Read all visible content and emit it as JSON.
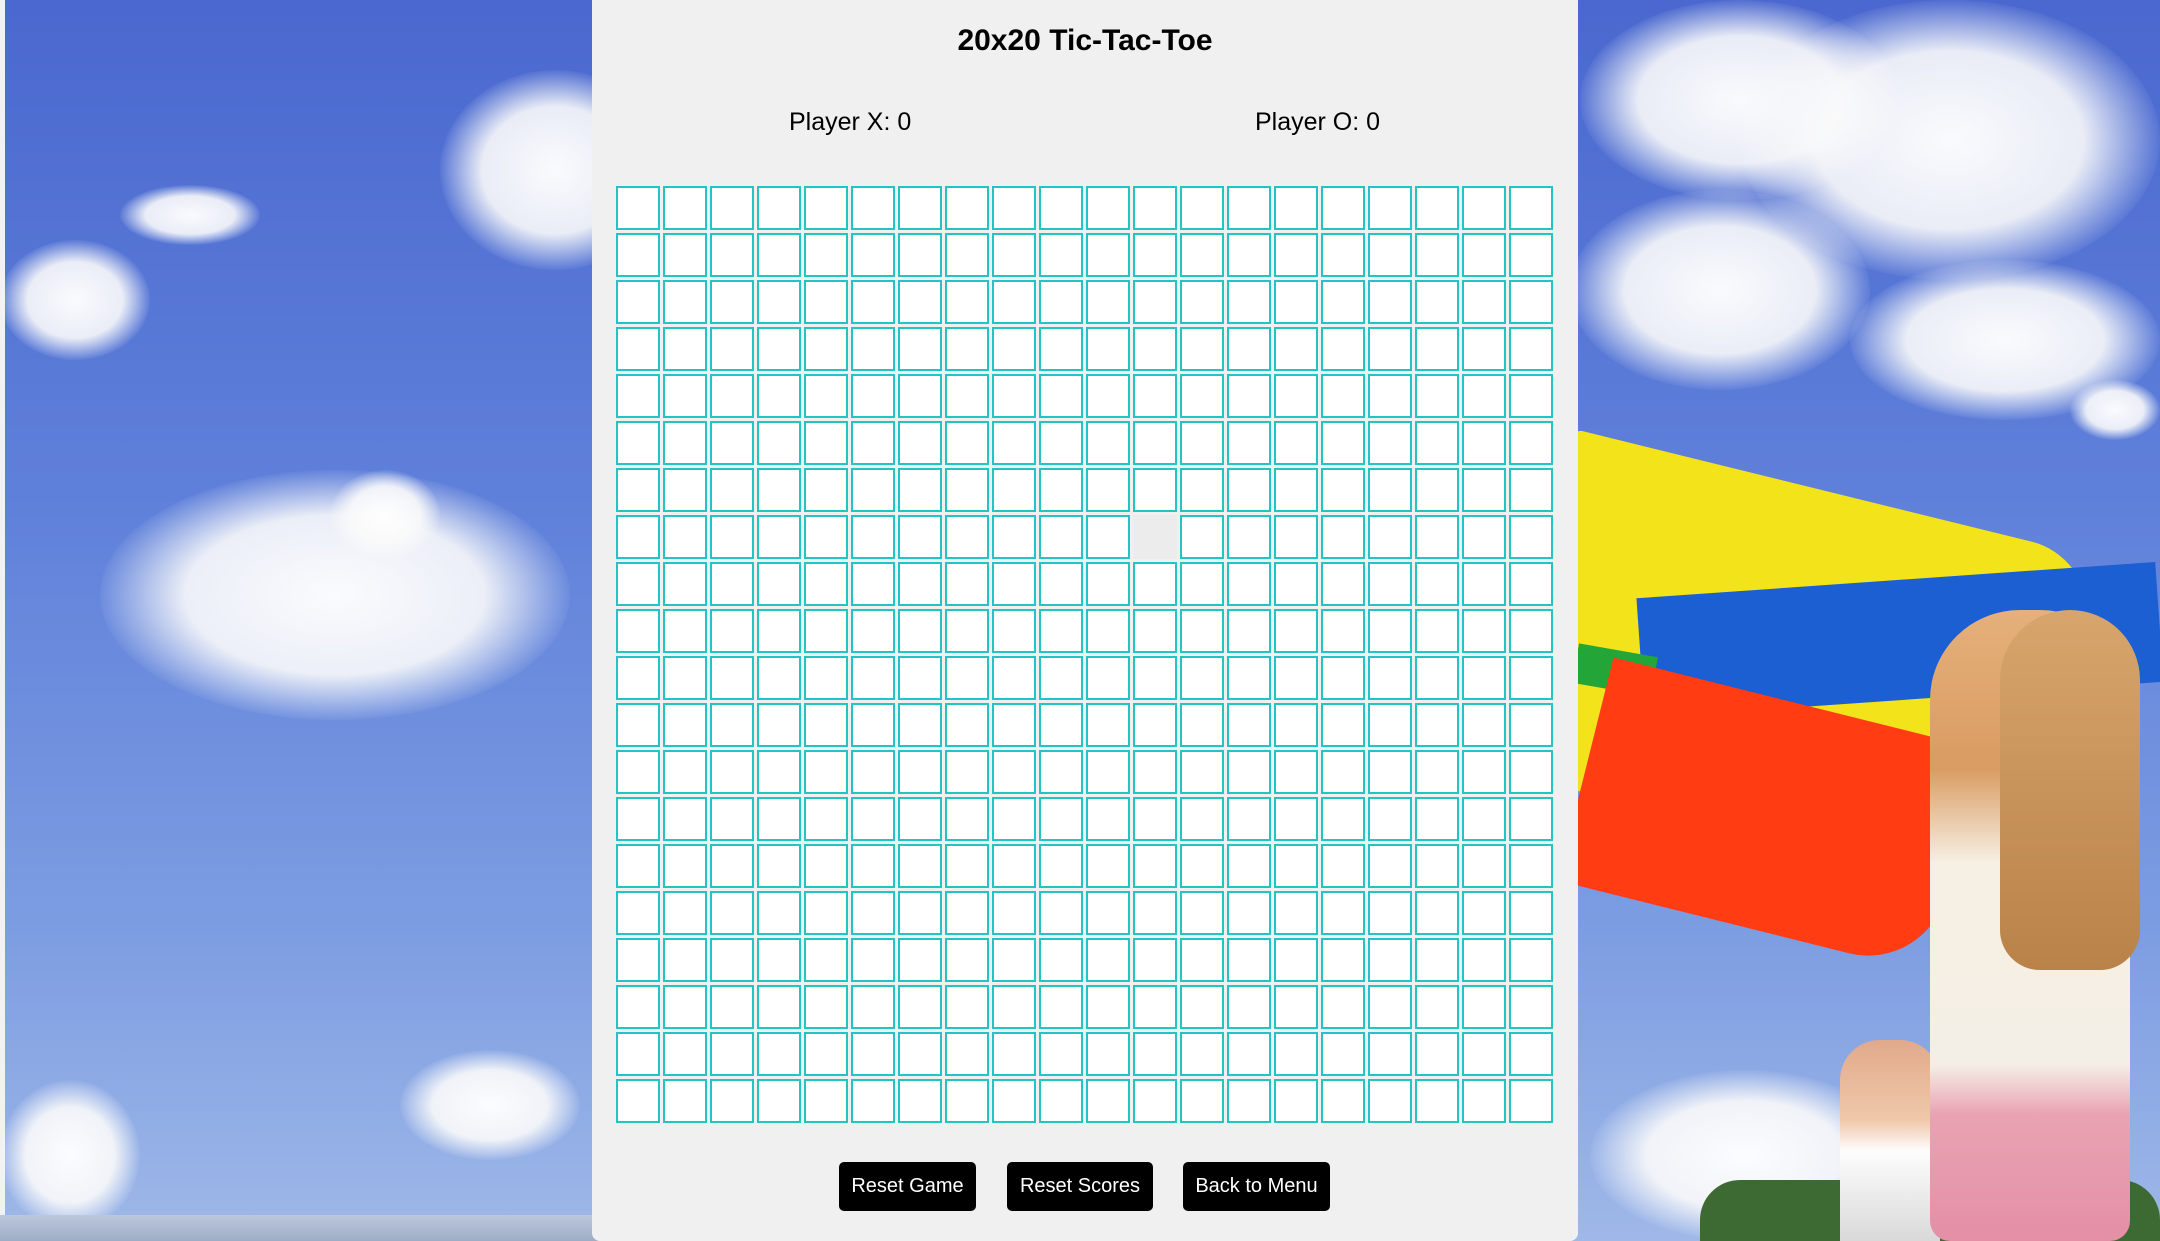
{
  "game": {
    "title": "20x20 Tic-Tac-Toe",
    "score_x_label": "Player X: 0",
    "score_o_label": "Player O: 0",
    "board_size": 20,
    "board": [],
    "hovered_cell": {
      "row": 7,
      "col": 11
    }
  },
  "buttons": {
    "reset_game": "Reset Game",
    "reset_scores": "Reset Scores",
    "back_to_menu": "Back to Menu"
  },
  "colors": {
    "panel_bg": "#f0f0f0",
    "cell_border": "#22c4c4",
    "button_bg": "#000000",
    "button_text": "#ffffff"
  }
}
